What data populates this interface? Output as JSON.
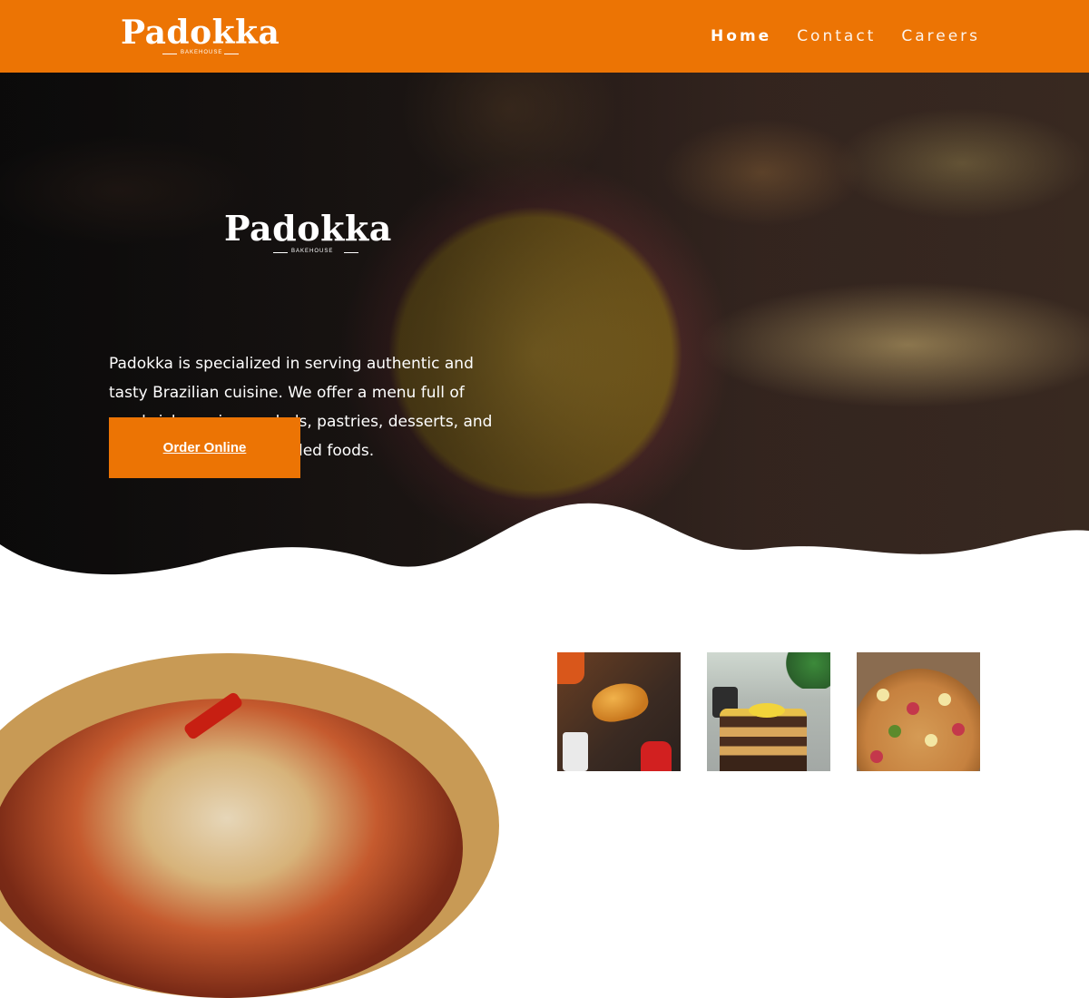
{
  "header": {
    "brand": "Padokka",
    "brand_sub": "BAKEHOUSE",
    "nav": [
      {
        "label": "Home",
        "active": true
      },
      {
        "label": "Contact",
        "active": false
      },
      {
        "label": "Careers",
        "active": false
      }
    ]
  },
  "hero": {
    "brand": "Padokka",
    "brand_sub": "BAKEHOUSE",
    "description": "Padokka is specialized in serving authentic and tasty Brazilian cuisine. We offer a menu full of sandwiches, pizza, salads, pastries, desserts, and many other Brazilian-styled foods.",
    "cta_label": "Order Online"
  },
  "colors": {
    "brand_orange": "#ec7404",
    "text_white": "#ffffff"
  }
}
